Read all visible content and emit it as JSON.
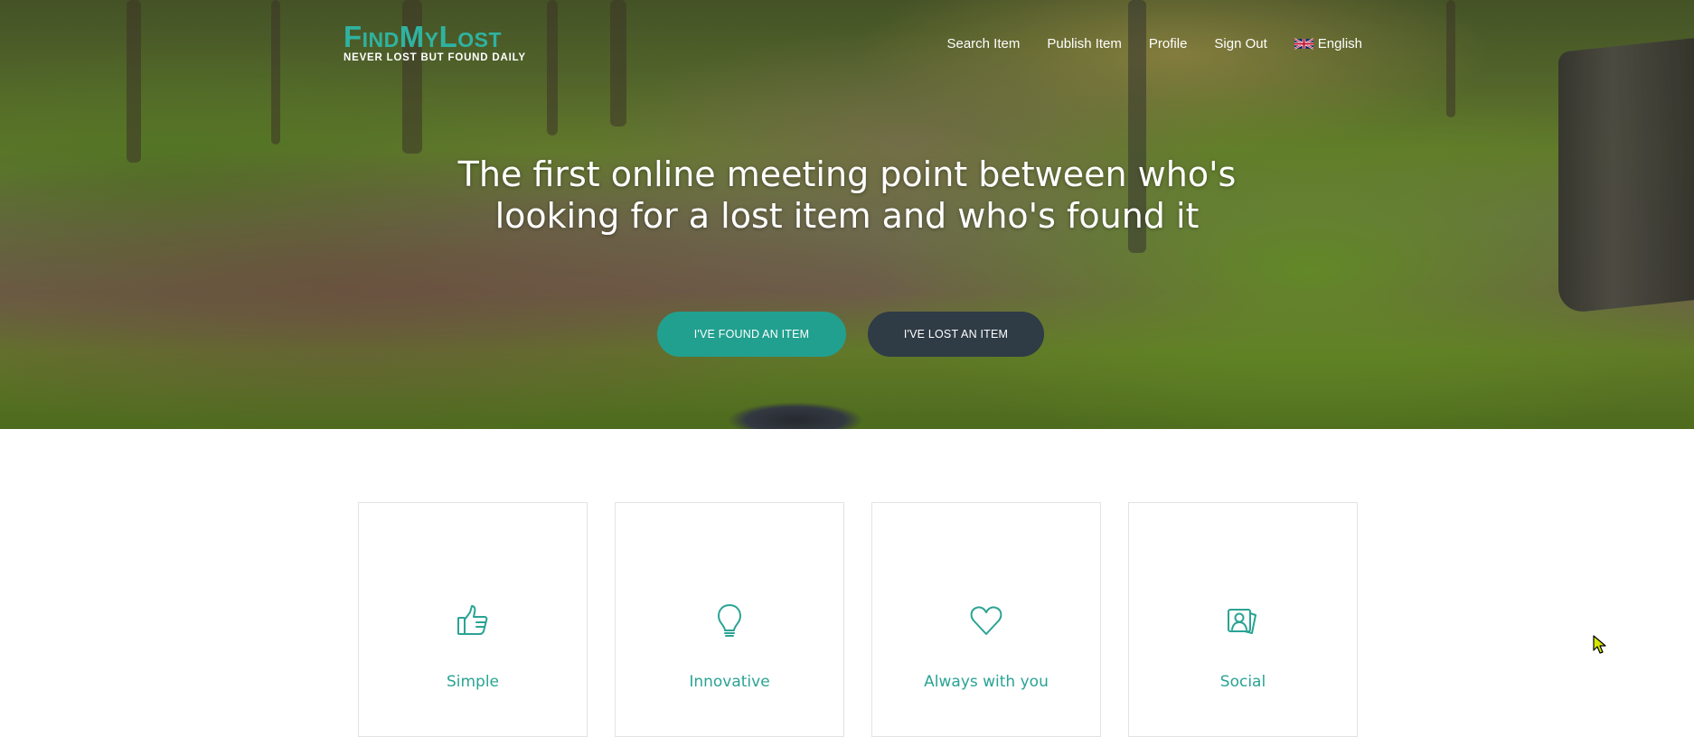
{
  "brand": {
    "name": "FindMyLost",
    "tagline": "NEVER LOST BUT FOUND DAILY",
    "accent_color": "#2fb3a0"
  },
  "nav": {
    "items": [
      {
        "label": "Search Item"
      },
      {
        "label": "Publish Item"
      },
      {
        "label": "Profile"
      },
      {
        "label": "Sign Out"
      }
    ],
    "language": {
      "label": "English",
      "icon": "uk-flag-icon"
    }
  },
  "hero": {
    "headline_line1": "The first online meeting point between who's",
    "headline_line2": "looking for a lost item and who's found it",
    "found_button": "I've found an item",
    "lost_button": "I've lost an item",
    "found_button_color": "#22a08f",
    "lost_button_color": "#2f3b45"
  },
  "features": [
    {
      "title": "Simple",
      "icon": "thumbs-up-icon"
    },
    {
      "title": "Innovative",
      "icon": "lightbulb-icon"
    },
    {
      "title": "Always with you",
      "icon": "heart-icon"
    },
    {
      "title": "Social",
      "icon": "contact-card-icon"
    }
  ]
}
